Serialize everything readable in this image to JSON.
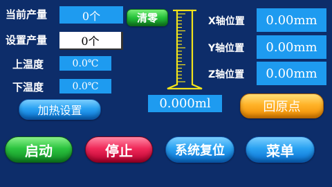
{
  "left_panel": {
    "current_output_label": "当前产量",
    "current_output_value": "0个",
    "clear_button": "清零",
    "set_output_label": "设置产量",
    "set_output_value": "0个",
    "upper_temp_label": "上温度",
    "upper_temp_value": "0.0℃",
    "lower_temp_label": "下温度",
    "lower_temp_value": "0.0℃",
    "heat_settings_button": "加热设置"
  },
  "cylinder": {
    "volume_value": "0.000ml",
    "fill_level": 0
  },
  "right_panel": {
    "x_label": "X轴位置",
    "x_value": "0.00mm",
    "y_label": "Y轴位置",
    "y_value": "0.00mm",
    "z_label": "Z轴位置",
    "z_value": "0.00mm",
    "home_button": "回原点"
  },
  "bottom_bar": {
    "start": "启动",
    "stop": "停止",
    "reset": "系统复位",
    "menu": "菜单"
  },
  "colors": {
    "background": "#0d2d6a",
    "value_box": "#1e9bf0",
    "cylinder_outline": "#f3e41a"
  }
}
